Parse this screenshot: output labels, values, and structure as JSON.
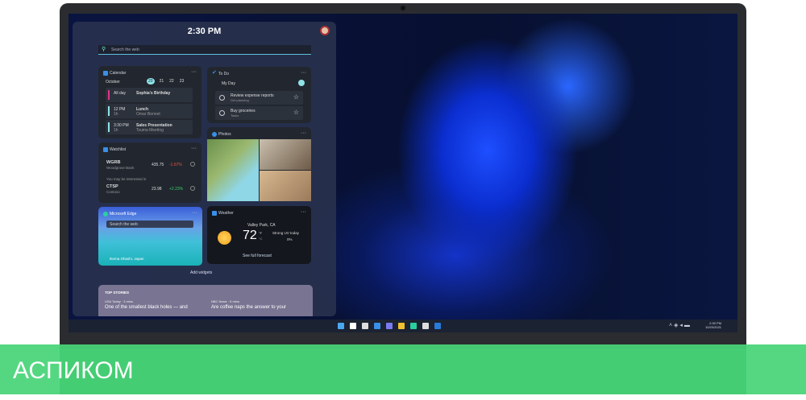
{
  "widgets": {
    "time": "2:30 PM",
    "search_placeholder": "Search the web",
    "calendar": {
      "title": "Calendar",
      "month": "October",
      "days": [
        "20",
        "21",
        "22",
        "23"
      ],
      "events": [
        {
          "time": "All day",
          "dur": "",
          "title": "Sophia's Birthday",
          "sub": "",
          "color": "#e0338a"
        },
        {
          "time": "12 PM",
          "dur": "1h",
          "title": "Lunch",
          "sub": "Omar Bennet",
          "color": "#8fe3e8"
        },
        {
          "time": "3:30 PM",
          "dur": "1h",
          "title": "Sales Presentation",
          "sub": "Tsuma Meeting",
          "color": "#8fe3e8"
        }
      ]
    },
    "todo": {
      "title": "To Do",
      "list": "My Day",
      "tasks": [
        {
          "title": "Review expense reports",
          "sub": "Get planning"
        },
        {
          "title": "Buy groceries",
          "sub": "Tasks"
        }
      ]
    },
    "photos": {
      "title": "Photos"
    },
    "watchlist": {
      "title": "Watchlist",
      "stocks": [
        {
          "sym": "WGRB",
          "name": "Woodgrove Bank",
          "price": "435.75",
          "change": "-1.67%",
          "color": "#e8553c"
        },
        {
          "sym": "CTSP",
          "name": "Contoso",
          "price": "23.98",
          "change": "+2.23%",
          "color": "#3cc96b"
        }
      ],
      "interest": "You may be interested in"
    },
    "edge": {
      "title": "Microsoft Edge",
      "search": "Search the web",
      "location": "Ikema Ohashi, Japan"
    },
    "weather": {
      "title": "Weather",
      "location": "Valley Park, CA",
      "temp": "72",
      "unit_f": "°F",
      "unit_c": "°C",
      "desc": "Strong UV today",
      "precip": "0%",
      "link": "See full forecast"
    },
    "add_widgets": "Add widgets",
    "top_stories": {
      "title": "TOP STORIES",
      "items": [
        {
          "source": "USA Today · 3 mins",
          "headline": "One of the smallest black holes — and"
        },
        {
          "source": "NBC News · 5 mins",
          "headline": "Are coffee naps the answer to your"
        }
      ]
    }
  },
  "taskbar": {
    "time": "2:30 PM",
    "date": "10/20/2021"
  },
  "banner": {
    "brand": "АСПИКОМ"
  }
}
